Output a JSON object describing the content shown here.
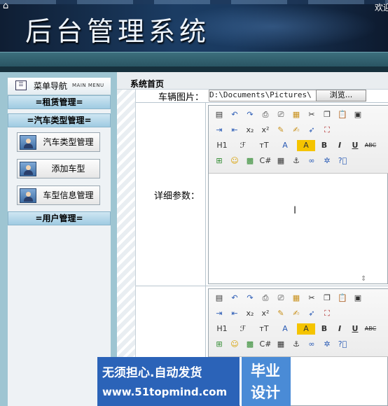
{
  "header": {
    "title": "后台管理系统"
  },
  "topbar": {
    "welcome": "欢迎"
  },
  "sidebar": {
    "title": "菜单导航",
    "subtitle": "MAIN MENU",
    "groups": [
      "=租赁管理=",
      "=汽车类型管理=",
      "=用户管理="
    ],
    "items": [
      {
        "label": "汽车类型管理",
        "icon": "user-icon"
      },
      {
        "label": "添加车型",
        "icon": "user-icon"
      },
      {
        "label": "车型信息管理",
        "icon": "user-icon"
      }
    ]
  },
  "main": {
    "breadcrumb": "系统首页",
    "image_label": "车辆图片：",
    "image_value": "D:\\Documents\\Pictures\\",
    "browse_label": "浏览...",
    "detail_label": "详细参数："
  },
  "editor": {
    "heading_btn": "H1",
    "font_btn": "ℱ",
    "size_btn": "тT",
    "color_btn": "A",
    "bold_btn": "B",
    "italic_btn": "I",
    "underline_btn": "U",
    "strike_btn": "ABC",
    "sub_btn": "x₂",
    "sup_btn": "x²"
  },
  "watermark": {
    "line1": "无须担心.自动发货",
    "line2": "www.51topmind.com",
    "right1": "毕业",
    "right2": "设计"
  }
}
